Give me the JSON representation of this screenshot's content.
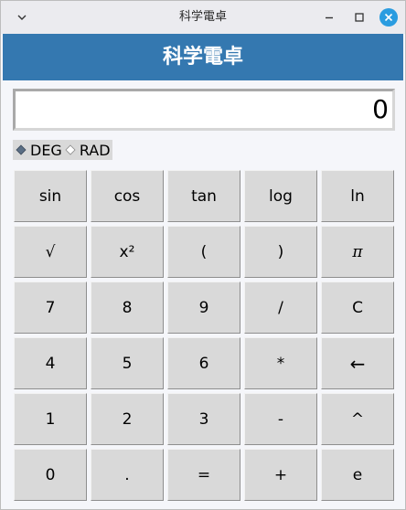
{
  "window": {
    "title": "科学電卓",
    "icons": {
      "menu": "chevron-down-icon",
      "minimize": "minimize-icon",
      "maximize": "maximize-icon",
      "close": "close-icon"
    },
    "close_color": "#2a9ce0"
  },
  "header": {
    "title": "科学電卓",
    "background": "#3478b0"
  },
  "display": {
    "value": "0"
  },
  "angle_mode": {
    "options": [
      {
        "label": "DEG",
        "selected": true
      },
      {
        "label": "RAD",
        "selected": false
      }
    ]
  },
  "keypad": {
    "rows": [
      [
        "sin",
        "cos",
        "tan",
        "log",
        "ln"
      ],
      [
        "√",
        "x²",
        "(",
        ")",
        "π"
      ],
      [
        "7",
        "8",
        "9",
        "/",
        "C"
      ],
      [
        "4",
        "5",
        "6",
        "*",
        "←"
      ],
      [
        "1",
        "2",
        "3",
        "-",
        "^"
      ],
      [
        "0",
        ".",
        "=",
        "+",
        "e"
      ]
    ]
  }
}
